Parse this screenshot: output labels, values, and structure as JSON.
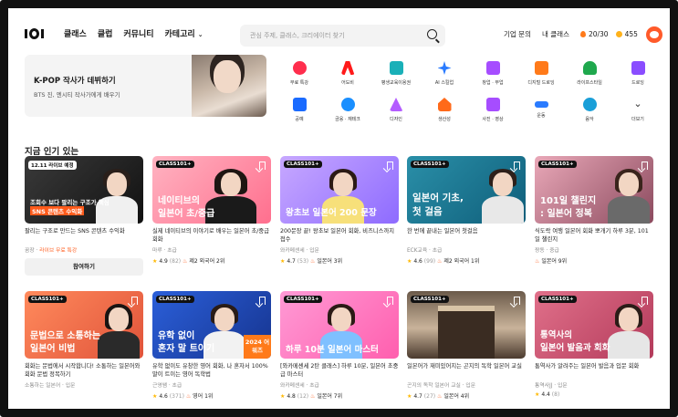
{
  "header": {
    "nav": [
      "클래스",
      "클럽",
      "커뮤니티",
      "카테고리"
    ],
    "search_placeholder": "관심 주제, 클래스, 크리에이터 찾기",
    "links": [
      "기업 문의",
      "내 클래스"
    ],
    "streak": "20/30",
    "coins": "455",
    "accent": "#ff5a1a"
  },
  "banner": {
    "title": "K-POP 작사가 데뷔하기",
    "subtitle": "BTS 진, 엔시티 작사가에게 배우기"
  },
  "categories": [
    {
      "label": "무료 특강",
      "icon": "live-icon",
      "color": "#ff2e4d"
    },
    {
      "label": "어도비",
      "icon": "adobe-icon",
      "color": "#ff1a1a"
    },
    {
      "label": "평생교육이용권",
      "icon": "infinity-icon",
      "color": "#1ab0b8"
    },
    {
      "label": "AI 스킬업",
      "icon": "sparkle-icon",
      "color": "#2a7bff"
    },
    {
      "label": "창업 · 부업",
      "icon": "shop-icon",
      "color": "#a64dff"
    },
    {
      "label": "디지털 드로잉",
      "icon": "tablet-icon",
      "color": "#ff7a1a"
    },
    {
      "label": "라이프스타일",
      "icon": "plant-icon",
      "color": "#1fa84d"
    },
    {
      "label": "드로잉",
      "icon": "pen-icon",
      "color": "#8a4dff"
    },
    {
      "label": "공예",
      "icon": "tools-icon",
      "color": "#1a6bff"
    },
    {
      "label": "금융 · 재테크",
      "icon": "won-icon",
      "color": "#1a8fff"
    },
    {
      "label": "디자인",
      "icon": "shapes-icon",
      "color": "#b45cff"
    },
    {
      "label": "생산성",
      "icon": "house-icon",
      "color": "#ff6a1a"
    },
    {
      "label": "사진 · 영상",
      "icon": "camera-icon",
      "color": "#a64dff"
    },
    {
      "label": "운동",
      "icon": "dumbbell-icon",
      "color": "#2a7bff"
    },
    {
      "label": "음악",
      "icon": "music-icon",
      "color": "#1a9fd8"
    },
    {
      "label": "더보기",
      "icon": "chevron-down-icon",
      "color": "#333333"
    }
  ],
  "section_title": "지금 인기 있는",
  "cards": [
    {
      "badge": "12.11 라이브 예정",
      "thumb_lines": [
        "조회수 보다 팔리는 구조가 핵심",
        "SNS 콘텐츠 수익화"
      ],
      "description": "팔리는 구조로 만드는 SNS 콘텐츠 수익화",
      "author": "꿈장",
      "promo": "라이브 무료 특강",
      "cta": "참여하기"
    },
    {
      "badge": "CLASS101+",
      "thumb_lines": [
        "네이티브의",
        "일본어 초/중급"
      ],
      "description": "실제 네이티브의 이야기로 배우는 일본어 초/중급 회화",
      "author": "마루",
      "level": "초급",
      "rating": "4.9",
      "count": "(82)",
      "rank": "제2 외국어 2위"
    },
    {
      "badge": "CLASS101+",
      "thumb_lines": [
        "왕초보 일본어 200 문장"
      ],
      "description": "200문장 끝! 왕초보 일본어 회화, 비즈니스까지 접수",
      "author": "와카메센세",
      "level": "입문",
      "rating": "4.7",
      "count": "(53)",
      "rank": "일본어 3위"
    },
    {
      "badge": "CLASS101+",
      "thumb_lines": [
        "일본어 기초,",
        "첫 걸음"
      ],
      "description": "한 번에 끝내는 일본어 첫걸음",
      "author": "ECK교육",
      "level": "초급",
      "rating": "4.6",
      "count": "(99)",
      "rank": "제2 외국어 1위"
    },
    {
      "badge": "CLASS101+",
      "thumb_lines": [
        "101일 챌린지",
        ": 일본어 정복"
      ],
      "description": "식도락 여행 일본어 회화 뽀개기 하루 3분, 101일 챌린지",
      "author": "짱동",
      "level": "중급",
      "rank": "일본어 9위"
    },
    {
      "badge": "CLASS101+",
      "thumb_lines": [
        "문법으로 소통하는",
        "일본어 비법"
      ],
      "description": "회화는 문법에서 시작합니다! 소통하는 일본어와 회화 문법 정복하기",
      "author": "소통하는 일본어",
      "level": "입문"
    },
    {
      "badge": "CLASS101+",
      "thumb_lines": [
        "유학 없이",
        "혼자 말 트이기"
      ],
      "tag": "2024 어워즈",
      "description": "유학 없이도 유창한 영어 회화, 나 혼자서 100% 말이 트이는 영어 독학법",
      "author": "근영쌤",
      "level": "초급",
      "rating": "4.6",
      "count": "(371)",
      "rank": "영어 1위"
    },
    {
      "badge": "CLASS101+",
      "thumb_lines": [
        "하루 10분 일본어 마스터"
      ],
      "description": "[와카메센세 2탄 클래스] 하루 10분, 일본어 초중급 마스터",
      "author": "와카메센세",
      "level": "초급",
      "rating": "4.8",
      "count": "(12)",
      "rank": "일본어 7위"
    },
    {
      "badge": "CLASS101+",
      "thumb_lines": [],
      "description": "일본어가 재미있어지는 곤지의 독학 일본어 교실",
      "author": "곤지의 독학 일본어 교실",
      "level": "입문",
      "rating": "4.7",
      "count": "(27)",
      "rank": "일본어 4위"
    },
    {
      "badge": "CLASS101+",
      "thumb_lines": [
        "통역사의",
        "일본어 발음과 회화"
      ],
      "description": "통역사가 알려주는 일본어 발음과 입문 회화",
      "author": "통역사JJ",
      "level": "입문",
      "rating": "4.4",
      "count": "(8)"
    }
  ]
}
